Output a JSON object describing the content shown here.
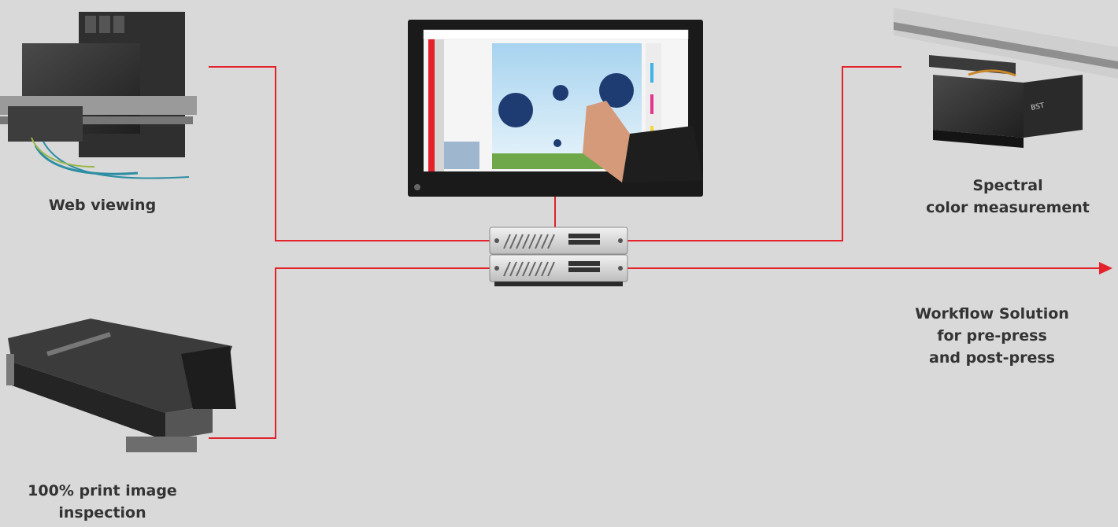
{
  "colors": {
    "background": "#d9d9d9",
    "connector": "#e3222b",
    "label_text": "#333333"
  },
  "devices": {
    "web_viewing": {
      "label": "Web viewing",
      "icon": "camera-unit-icon"
    },
    "print_inspection": {
      "label": "100% print image\ninspection",
      "icon": "inspection-bar-icon"
    },
    "monitor": {
      "icon": "touchscreen-monitor-icon"
    },
    "spectral": {
      "label": "Spectral\ncolor measurement",
      "icon": "spectral-sensor-icon"
    },
    "workflow": {
      "label": "Workflow Solution\nfor pre-press\nand post-press",
      "icon": "arrow-right-icon"
    },
    "server": {
      "icon": "rack-server-icon"
    }
  }
}
